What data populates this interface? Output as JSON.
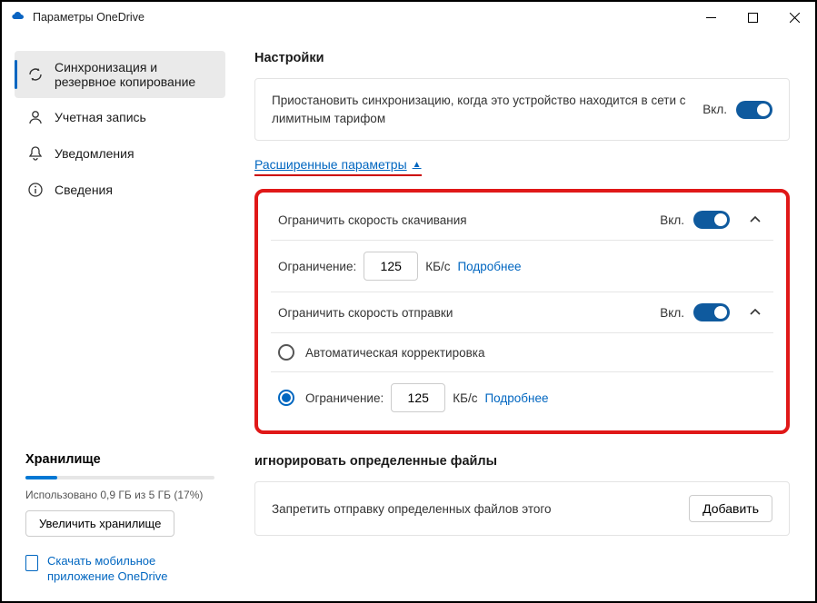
{
  "window": {
    "title": "Параметры OneDrive"
  },
  "sidebar": {
    "items": [
      {
        "label": "Синхронизация и резервное копирование"
      },
      {
        "label": "Учетная запись"
      },
      {
        "label": "Уведомления"
      },
      {
        "label": "Сведения"
      }
    ],
    "storage": {
      "title": "Хранилище",
      "used_text": "Использовано 0,9 ГБ из 5 ГБ (17%)",
      "percent": 17,
      "upgrade_label": "Увеличить хранилище"
    },
    "mobile": {
      "text": "Скачать мобильное приложение OneDrive"
    }
  },
  "main": {
    "section_title": "Настройки",
    "metered": {
      "text": "Приостановить синхронизацию, когда это устройство находится в сети с лимитным тарифом",
      "state": "Вкл."
    },
    "advanced_label": "Расширенные параметры",
    "download": {
      "title": "Ограничить скорость скачивания",
      "state": "Вкл.",
      "limit_label": "Ограничение:",
      "value": "125",
      "unit": "КБ/с",
      "more": "Подробнее"
    },
    "upload": {
      "title": "Ограничить скорость отправки",
      "state": "Вкл.",
      "auto_label": "Автоматическая корректировка",
      "limit_label": "Ограничение:",
      "value": "125",
      "unit": "КБ/с",
      "more": "Подробнее"
    },
    "ignore": {
      "title": "игнорировать определенные файлы",
      "text": "Запретить отправку определенных файлов этого",
      "add": "Добавить"
    }
  }
}
